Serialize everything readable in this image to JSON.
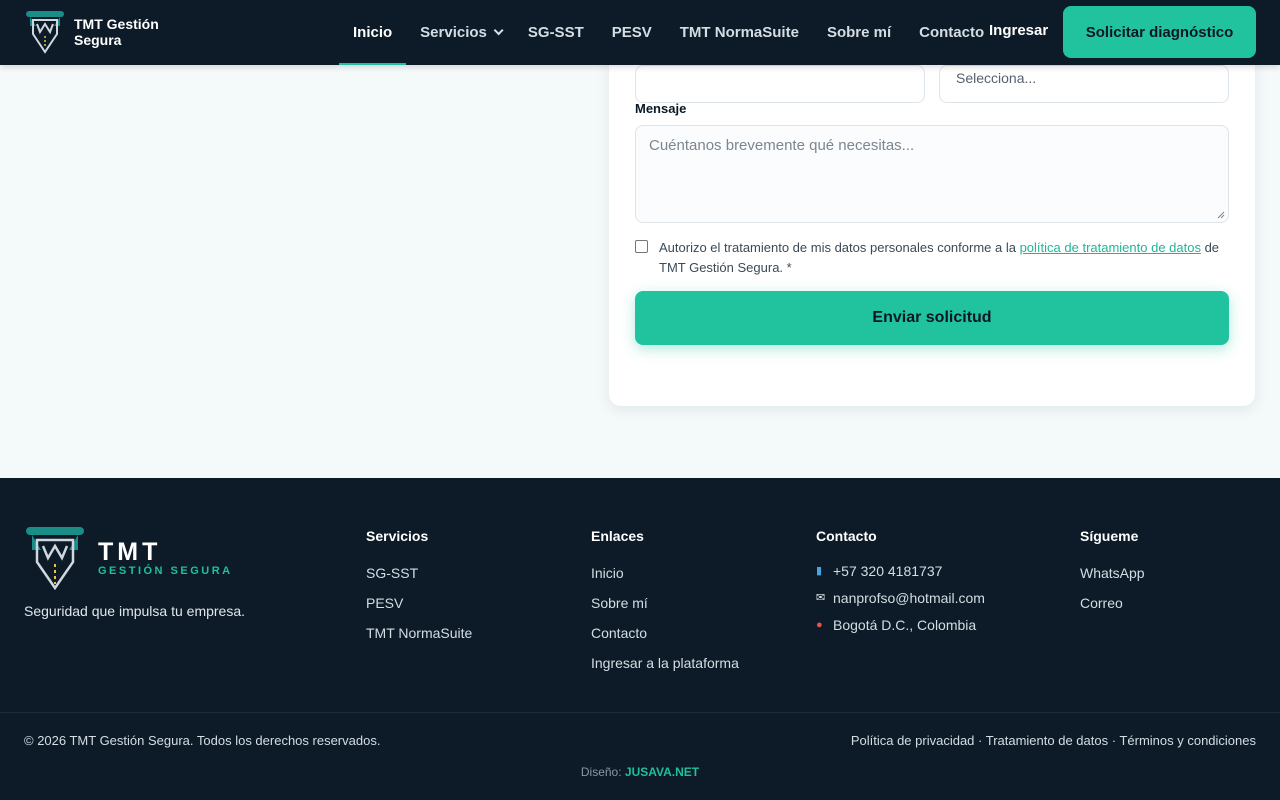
{
  "header": {
    "brand_line1": "TMT Gestión",
    "brand_line2": "Segura",
    "nav": [
      {
        "label": "Inicio"
      },
      {
        "label": "Servicios"
      },
      {
        "label": "SG-SST"
      },
      {
        "label": "PESV"
      },
      {
        "label": "TMT NormaSuite"
      },
      {
        "label": "Sobre mí"
      },
      {
        "label": "Contacto"
      }
    ],
    "login_label": "Ingresar",
    "cta_label": "Solicitar diagnóstico"
  },
  "form": {
    "select_value": "Selecciona...",
    "message_label": "Mensaje",
    "message_placeholder": "Cuéntanos brevemente qué necesitas...",
    "consent_before": "Autorizo el tratamiento de mis datos personales conforme a la ",
    "consent_link": "política de tratamiento de datos",
    "consent_after": " de TMT Gestión Segura. *",
    "submit_label": "Enviar solicitud"
  },
  "footer": {
    "logo_big": "TMT",
    "logo_small": "GESTIÓN SEGURA",
    "tagline": "Seguridad que impulsa tu empresa.",
    "services": {
      "title": "Servicios",
      "items": [
        "SG-SST",
        "PESV",
        "TMT NormaSuite"
      ]
    },
    "links": {
      "title": "Enlaces",
      "items": [
        "Inicio",
        "Sobre mí",
        "Contacto",
        "Ingresar a la plataforma"
      ]
    },
    "contact": {
      "title": "Contacto",
      "phone": "+57 320 4181737",
      "email": "nanprofso@hotmail.com",
      "location": "Bogotá D.C., Colombia"
    },
    "follow": {
      "title": "Sígueme",
      "items": [
        "WhatsApp",
        "Correo"
      ]
    },
    "copyright": "© 2026 TMT Gestión Segura. Todos los derechos reservados.",
    "legal": [
      "Política de privacidad",
      "Tratamiento de datos",
      "Términos y condiciones"
    ],
    "legal_sep": " · ",
    "design_label": "Diseño: ",
    "design_name": "JUSAVA.NET"
  },
  "colors": {
    "accent": "#21c39f",
    "dark": "#0c1b27"
  }
}
